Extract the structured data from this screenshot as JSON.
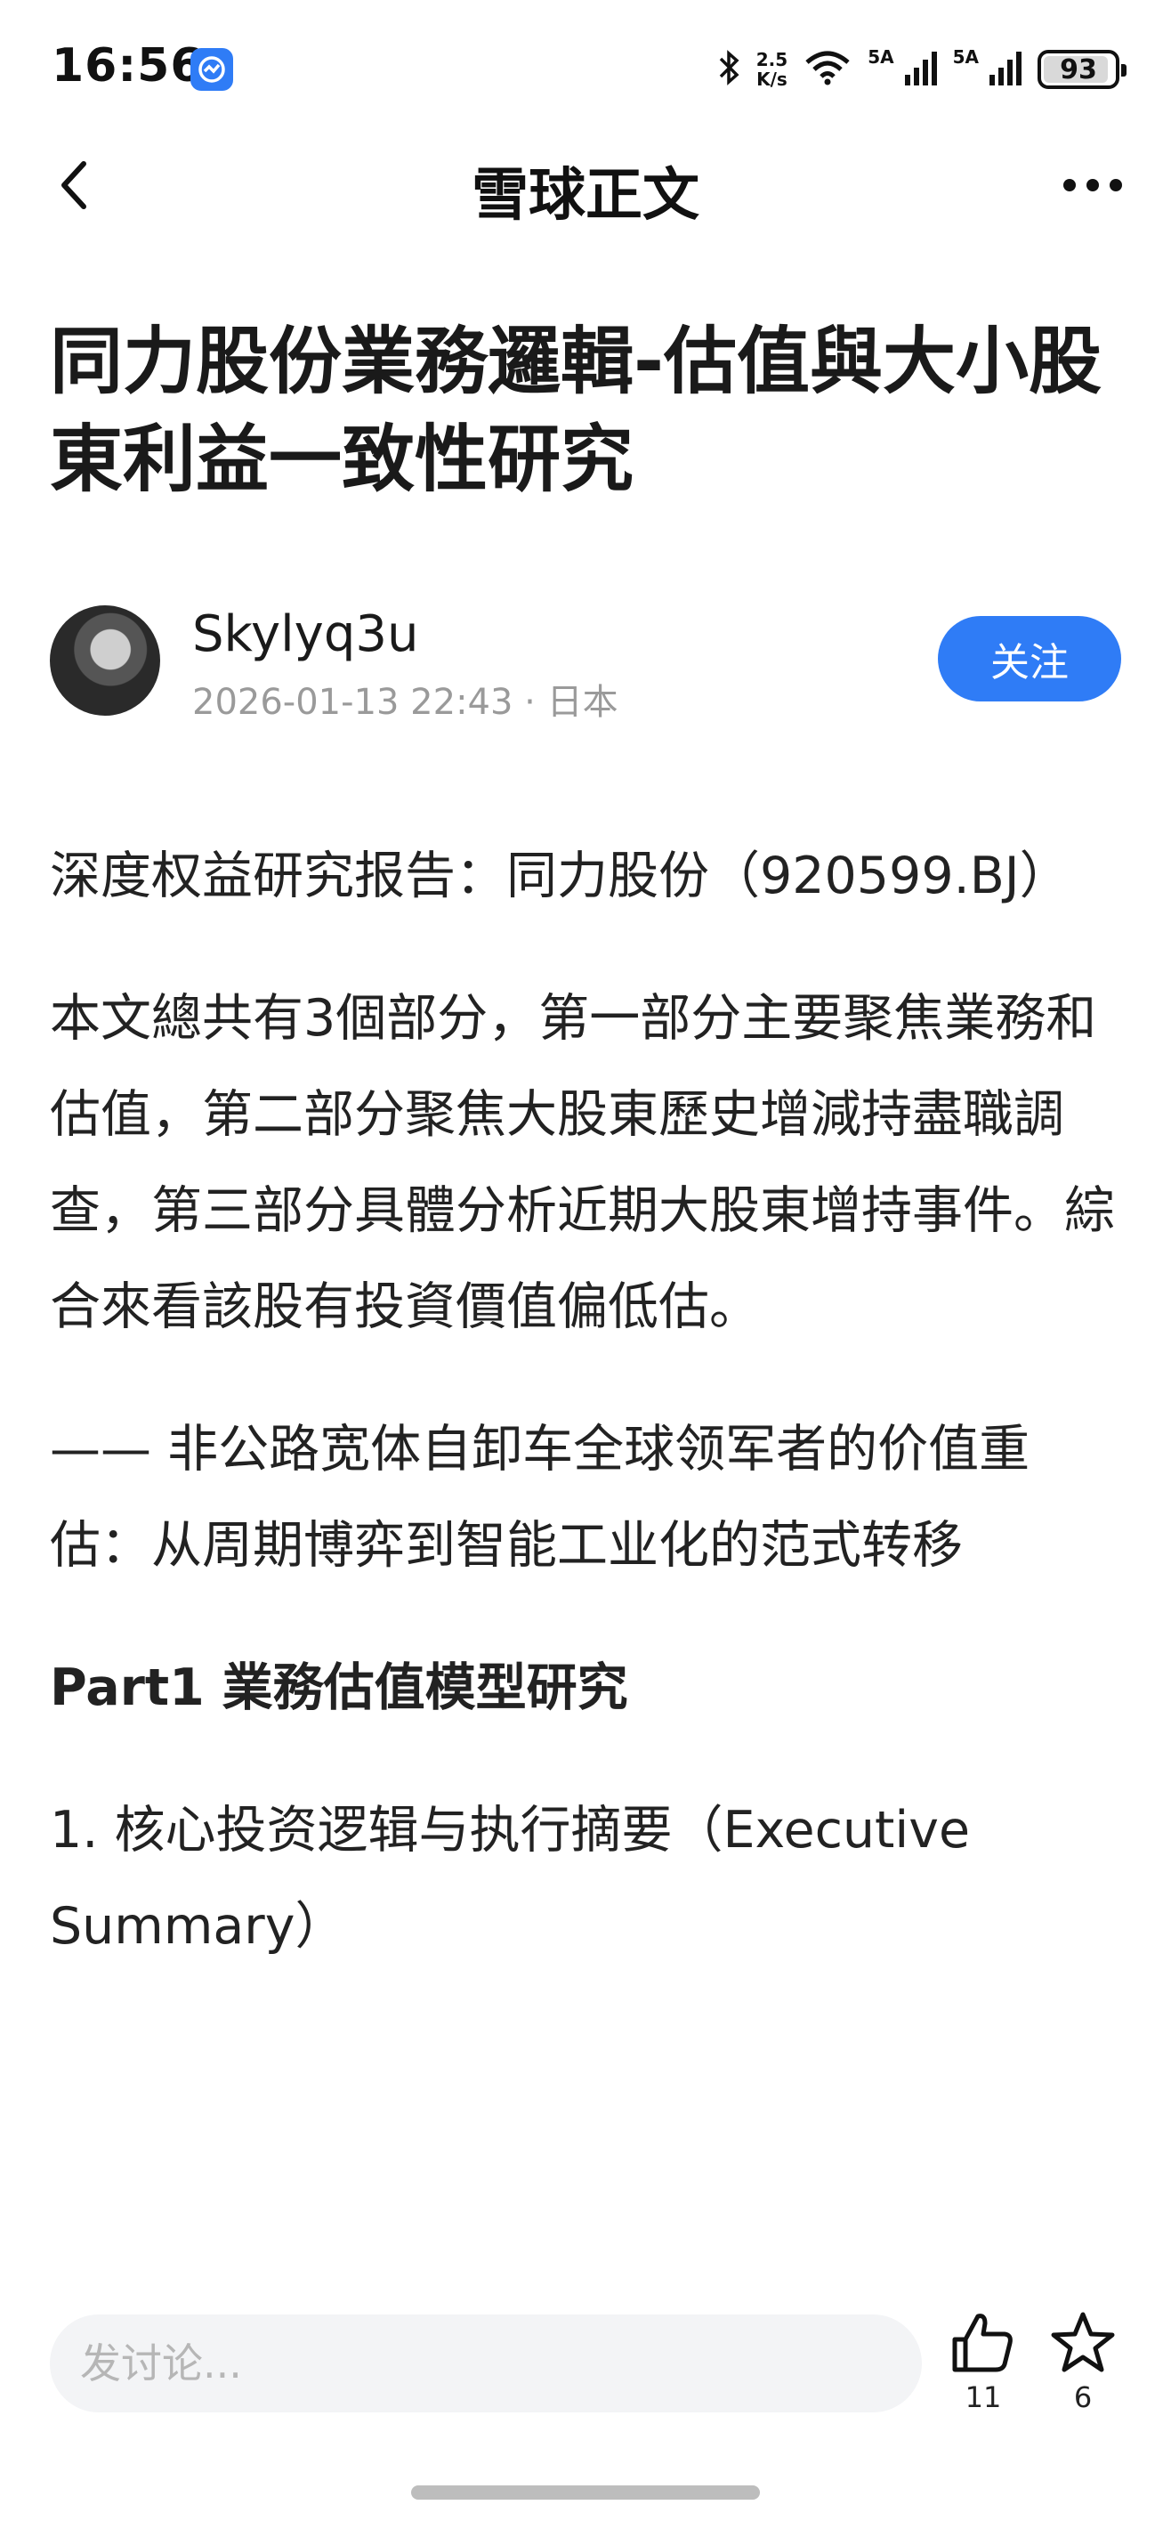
{
  "status_bar": {
    "time": "16:56",
    "net_speed_value": "2.5",
    "net_speed_unit": "K/s",
    "signal1_label": "5A",
    "signal2_label": "5A",
    "battery": "93",
    "battery_level": 0.93
  },
  "nav": {
    "title": "雪球正文",
    "back_icon": "chevron-left-icon",
    "more_icon": "more-horizontal-icon"
  },
  "article": {
    "title": "同力股份業務邏輯-估值與大小股東利益一致性研究",
    "author": {
      "name": "Skylyq3u",
      "meta": "2026-01-13 22:43 · 日本",
      "follow_label": "关注"
    },
    "paragraphs": [
      "深度权益研究报告：同力股份（920599.BJ）",
      "本文總共有3個部分，第一部分主要聚焦業務和估值，第二部分聚焦大股東歷史增減持盡職調查，第三部分具體分析近期大股東增持事件。綜合來看該股有投資價值偏低估。",
      "—— 非公路宽体自卸车全球领军者的价值重估：从周期博弈到智能工业化的范式转移",
      "Part1 業務估值模型研究",
      "1. 核心投资逻辑与执行摘要（Executive Summary）"
    ]
  },
  "bottom_bar": {
    "comment_placeholder": "发讨论...",
    "like_count": "11",
    "favorite_count": "6"
  },
  "colors": {
    "accent": "#2f7cf6",
    "meta_text": "#9a9a9a",
    "input_bg": "#f3f4f6"
  }
}
